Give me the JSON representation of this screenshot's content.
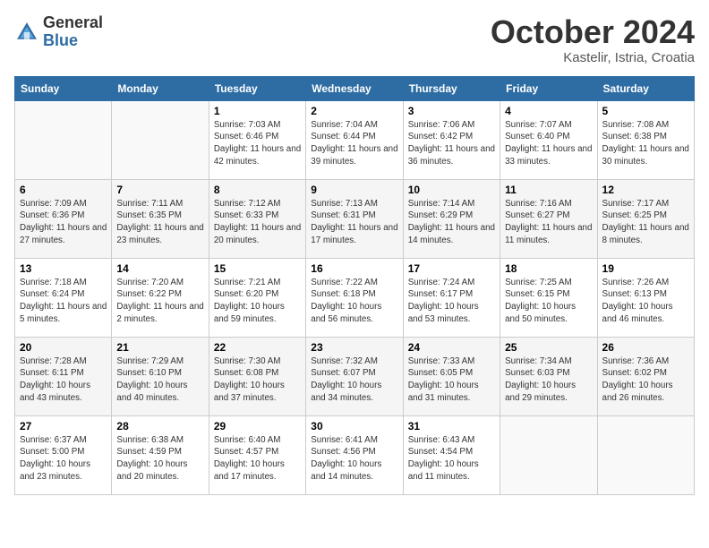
{
  "header": {
    "logo_general": "General",
    "logo_blue": "Blue",
    "month_title": "October 2024",
    "subtitle": "Kastelir, Istria, Croatia"
  },
  "weekdays": [
    "Sunday",
    "Monday",
    "Tuesday",
    "Wednesday",
    "Thursday",
    "Friday",
    "Saturday"
  ],
  "weeks": [
    [
      {
        "day": "",
        "info": ""
      },
      {
        "day": "",
        "info": ""
      },
      {
        "day": "1",
        "info": "Sunrise: 7:03 AM\nSunset: 6:46 PM\nDaylight: 11 hours and 42 minutes."
      },
      {
        "day": "2",
        "info": "Sunrise: 7:04 AM\nSunset: 6:44 PM\nDaylight: 11 hours and 39 minutes."
      },
      {
        "day": "3",
        "info": "Sunrise: 7:06 AM\nSunset: 6:42 PM\nDaylight: 11 hours and 36 minutes."
      },
      {
        "day": "4",
        "info": "Sunrise: 7:07 AM\nSunset: 6:40 PM\nDaylight: 11 hours and 33 minutes."
      },
      {
        "day": "5",
        "info": "Sunrise: 7:08 AM\nSunset: 6:38 PM\nDaylight: 11 hours and 30 minutes."
      }
    ],
    [
      {
        "day": "6",
        "info": "Sunrise: 7:09 AM\nSunset: 6:36 PM\nDaylight: 11 hours and 27 minutes."
      },
      {
        "day": "7",
        "info": "Sunrise: 7:11 AM\nSunset: 6:35 PM\nDaylight: 11 hours and 23 minutes."
      },
      {
        "day": "8",
        "info": "Sunrise: 7:12 AM\nSunset: 6:33 PM\nDaylight: 11 hours and 20 minutes."
      },
      {
        "day": "9",
        "info": "Sunrise: 7:13 AM\nSunset: 6:31 PM\nDaylight: 11 hours and 17 minutes."
      },
      {
        "day": "10",
        "info": "Sunrise: 7:14 AM\nSunset: 6:29 PM\nDaylight: 11 hours and 14 minutes."
      },
      {
        "day": "11",
        "info": "Sunrise: 7:16 AM\nSunset: 6:27 PM\nDaylight: 11 hours and 11 minutes."
      },
      {
        "day": "12",
        "info": "Sunrise: 7:17 AM\nSunset: 6:25 PM\nDaylight: 11 hours and 8 minutes."
      }
    ],
    [
      {
        "day": "13",
        "info": "Sunrise: 7:18 AM\nSunset: 6:24 PM\nDaylight: 11 hours and 5 minutes."
      },
      {
        "day": "14",
        "info": "Sunrise: 7:20 AM\nSunset: 6:22 PM\nDaylight: 11 hours and 2 minutes."
      },
      {
        "day": "15",
        "info": "Sunrise: 7:21 AM\nSunset: 6:20 PM\nDaylight: 10 hours and 59 minutes."
      },
      {
        "day": "16",
        "info": "Sunrise: 7:22 AM\nSunset: 6:18 PM\nDaylight: 10 hours and 56 minutes."
      },
      {
        "day": "17",
        "info": "Sunrise: 7:24 AM\nSunset: 6:17 PM\nDaylight: 10 hours and 53 minutes."
      },
      {
        "day": "18",
        "info": "Sunrise: 7:25 AM\nSunset: 6:15 PM\nDaylight: 10 hours and 50 minutes."
      },
      {
        "day": "19",
        "info": "Sunrise: 7:26 AM\nSunset: 6:13 PM\nDaylight: 10 hours and 46 minutes."
      }
    ],
    [
      {
        "day": "20",
        "info": "Sunrise: 7:28 AM\nSunset: 6:11 PM\nDaylight: 10 hours and 43 minutes."
      },
      {
        "day": "21",
        "info": "Sunrise: 7:29 AM\nSunset: 6:10 PM\nDaylight: 10 hours and 40 minutes."
      },
      {
        "day": "22",
        "info": "Sunrise: 7:30 AM\nSunset: 6:08 PM\nDaylight: 10 hours and 37 minutes."
      },
      {
        "day": "23",
        "info": "Sunrise: 7:32 AM\nSunset: 6:07 PM\nDaylight: 10 hours and 34 minutes."
      },
      {
        "day": "24",
        "info": "Sunrise: 7:33 AM\nSunset: 6:05 PM\nDaylight: 10 hours and 31 minutes."
      },
      {
        "day": "25",
        "info": "Sunrise: 7:34 AM\nSunset: 6:03 PM\nDaylight: 10 hours and 29 minutes."
      },
      {
        "day": "26",
        "info": "Sunrise: 7:36 AM\nSunset: 6:02 PM\nDaylight: 10 hours and 26 minutes."
      }
    ],
    [
      {
        "day": "27",
        "info": "Sunrise: 6:37 AM\nSunset: 5:00 PM\nDaylight: 10 hours and 23 minutes."
      },
      {
        "day": "28",
        "info": "Sunrise: 6:38 AM\nSunset: 4:59 PM\nDaylight: 10 hours and 20 minutes."
      },
      {
        "day": "29",
        "info": "Sunrise: 6:40 AM\nSunset: 4:57 PM\nDaylight: 10 hours and 17 minutes."
      },
      {
        "day": "30",
        "info": "Sunrise: 6:41 AM\nSunset: 4:56 PM\nDaylight: 10 hours and 14 minutes."
      },
      {
        "day": "31",
        "info": "Sunrise: 6:43 AM\nSunset: 4:54 PM\nDaylight: 10 hours and 11 minutes."
      },
      {
        "day": "",
        "info": ""
      },
      {
        "day": "",
        "info": ""
      }
    ]
  ]
}
